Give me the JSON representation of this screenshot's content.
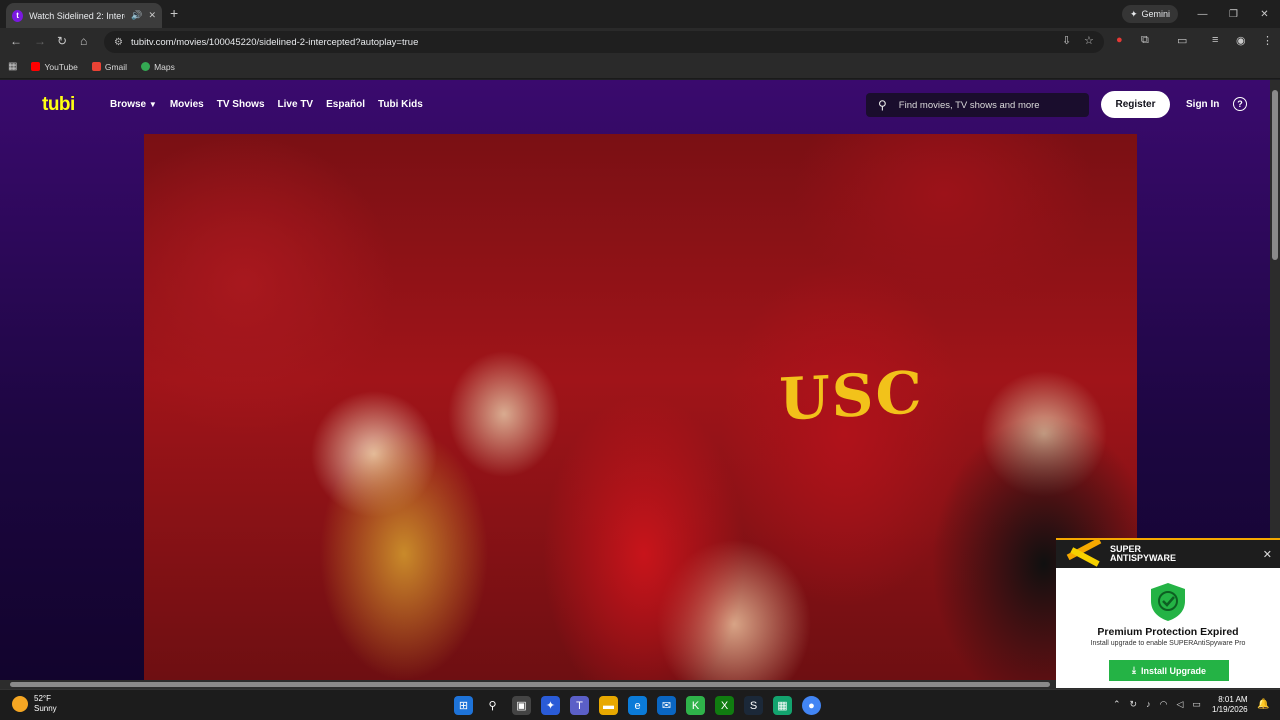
{
  "browser": {
    "tab_title": "Watch Sidelined 2: Intercepted",
    "url": "tubitv.com/movies/100045220/sidelined-2-intercepted?autoplay=true",
    "gemini_label": "Gemini",
    "bookmarks": [
      {
        "label": "YouTube",
        "color": "#ff0000"
      },
      {
        "label": "Gmail",
        "color": "#ea4335"
      },
      {
        "label": "Maps",
        "color": "#34a853"
      }
    ]
  },
  "tubi": {
    "logo": "tubi",
    "nav": [
      "Browse",
      "Movies",
      "TV Shows",
      "Live TV",
      "Español",
      "Tubi Kids"
    ],
    "search_placeholder": "Find movies, TV shows and more",
    "register_label": "Register",
    "signin_label": "Sign In",
    "help_glyph": "?",
    "video_overlay_text": "USC"
  },
  "popup": {
    "brand_line1": "SUPER",
    "brand_line2": "ANTISPYWARE",
    "title": "Premium Protection Expired",
    "subtitle": "Install upgrade to enable SUPERAntiSpyware Pro",
    "button_label": "Install Upgrade",
    "accent_color": "#24b345"
  },
  "taskbar": {
    "temperature": "52°F",
    "weather": "Sunny",
    "time": "8:01 AM",
    "date": "1/19/2026"
  }
}
